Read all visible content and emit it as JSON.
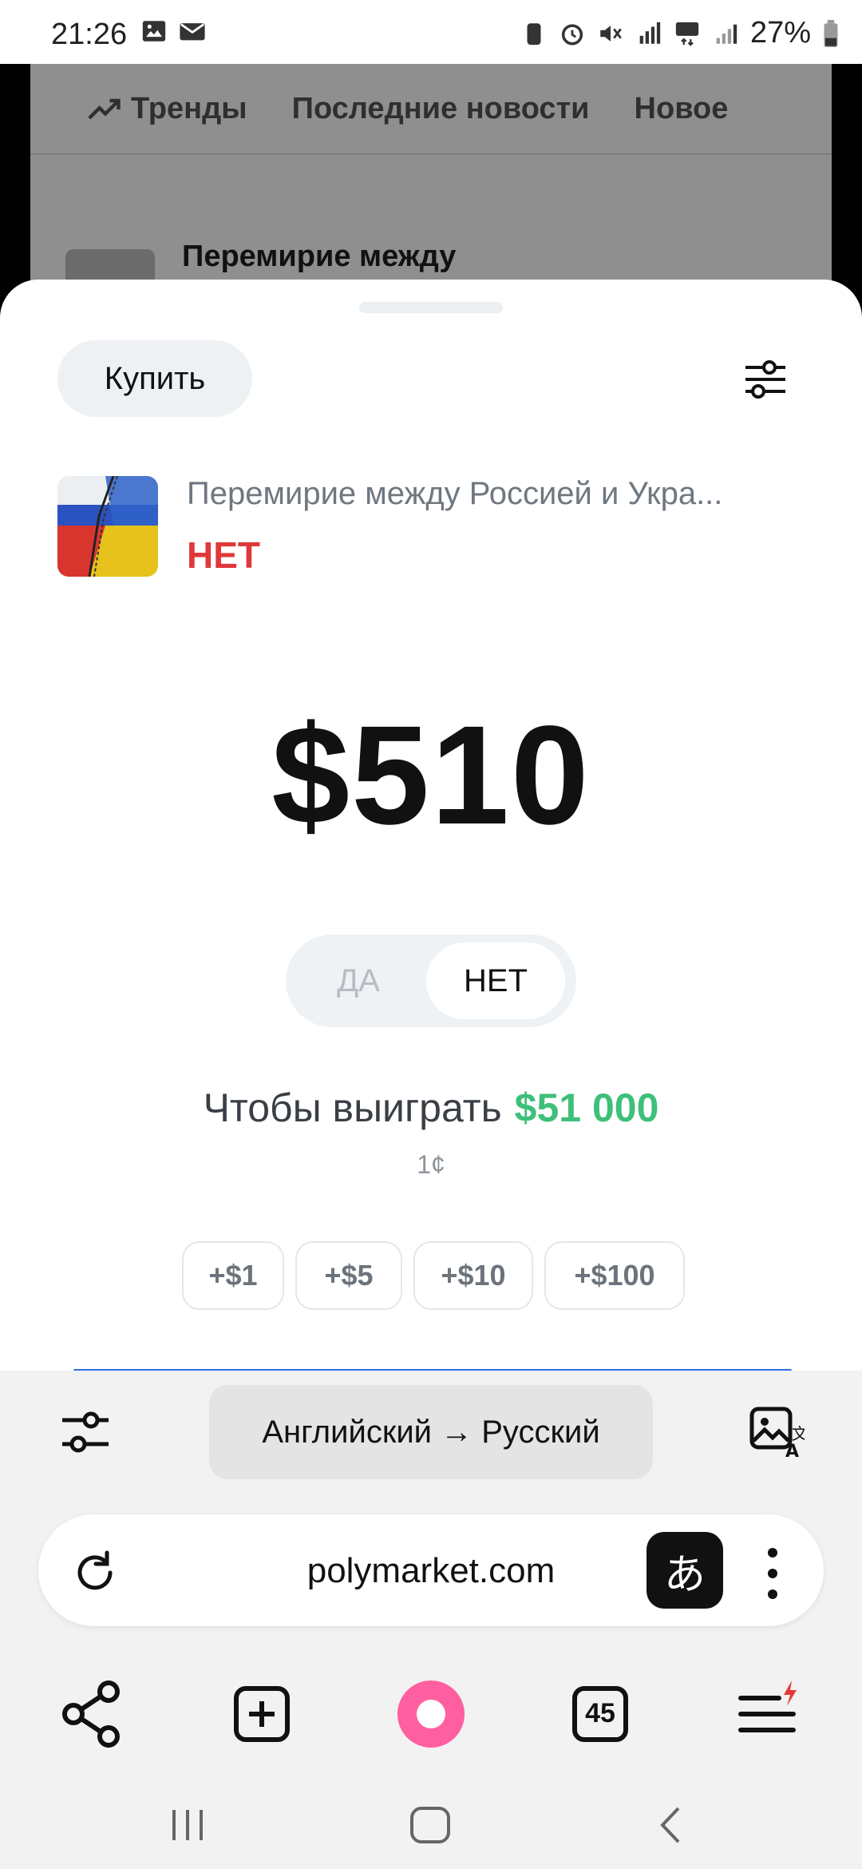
{
  "status_bar": {
    "time": "21:26",
    "battery": "27%"
  },
  "background_page": {
    "tabs": [
      "Тренды",
      "Последние новости",
      "Новое"
    ],
    "title": "Перемирие между"
  },
  "sheet": {
    "buy_tab": "Купить",
    "market_title": "Перемирие между Россией и Укра...",
    "market_side": "НЕТ",
    "amount": "$510",
    "toggle": {
      "yes": "ДА",
      "no": "НЕТ"
    },
    "to_win_label": "Чтобы выиграть",
    "to_win_value": "$51 000",
    "price": "1¢",
    "quick_amounts": [
      "+$1",
      "+$5",
      "+$10",
      "+$100"
    ]
  },
  "translate_bar": {
    "languages": "Английский → Русский"
  },
  "browser": {
    "url": "polymarket.com",
    "translate_glyph": "あ",
    "tabs_count": "45"
  },
  "colors": {
    "no_red": "#e0383a",
    "win_green": "#3ec07a",
    "alice_pink": "#ff5fa0"
  }
}
